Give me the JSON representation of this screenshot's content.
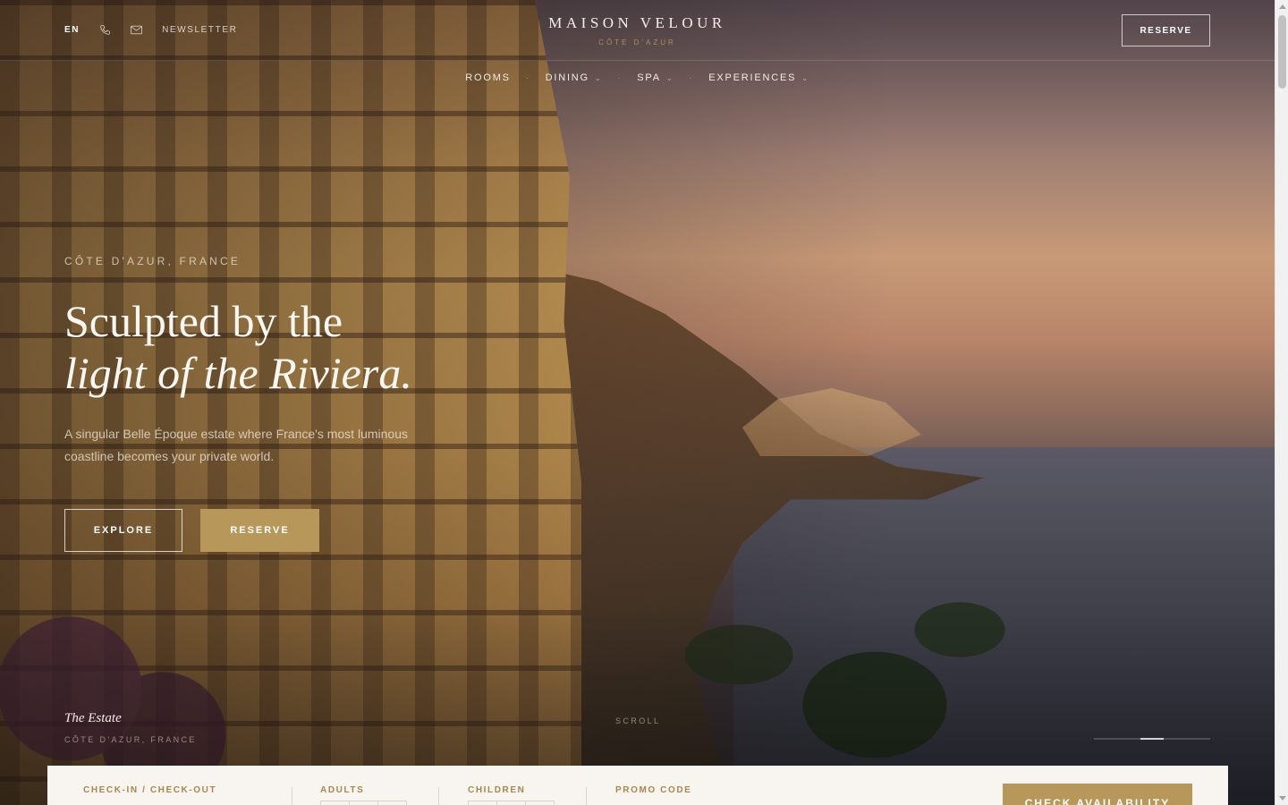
{
  "header": {
    "language": "EN",
    "newsletter_label": "NEWSLETTER",
    "brand_name": "MAISON VELOUR",
    "brand_subtitle": "CÔTE D'AZUR",
    "reserve_label": "RESERVE",
    "icons": [
      "phone-icon",
      "mail-icon"
    ]
  },
  "nav": {
    "items": [
      {
        "label": "ROOMS",
        "has_dropdown": false
      },
      {
        "label": "DINING",
        "has_dropdown": true
      },
      {
        "label": "SPA",
        "has_dropdown": true
      },
      {
        "label": "EXPERIENCES",
        "has_dropdown": true
      }
    ],
    "caret": "⌄",
    "separator": "·"
  },
  "hero": {
    "kicker": "CÔTE D'AZUR, FRANCE",
    "headline_line1": "Sculpted by the",
    "headline_line2": "light of the Riviera.",
    "lede": "A singular Belle Époque estate where France's most luminous coastline becomes your private world.",
    "explore_label": "EXPLORE",
    "reserve_label": "RESERVE",
    "slide_title": "The Estate",
    "slide_location": "CÔTE D'AZUR, FRANCE",
    "scroll_label": "SCROLL",
    "slide_progress": {
      "current": 2,
      "total": 3
    }
  },
  "booking": {
    "checkin_label": "CHECK-IN / CHECK-OUT",
    "adults_label": "ADULTS",
    "children_label": "CHILDREN",
    "promo_label": "PROMO CODE",
    "cta_label": "CHECK AVAILABILITY"
  },
  "colors": {
    "accent_gold": "#b8975a",
    "label_gold": "#a9874e",
    "booking_bg": "#f8f5f0"
  }
}
